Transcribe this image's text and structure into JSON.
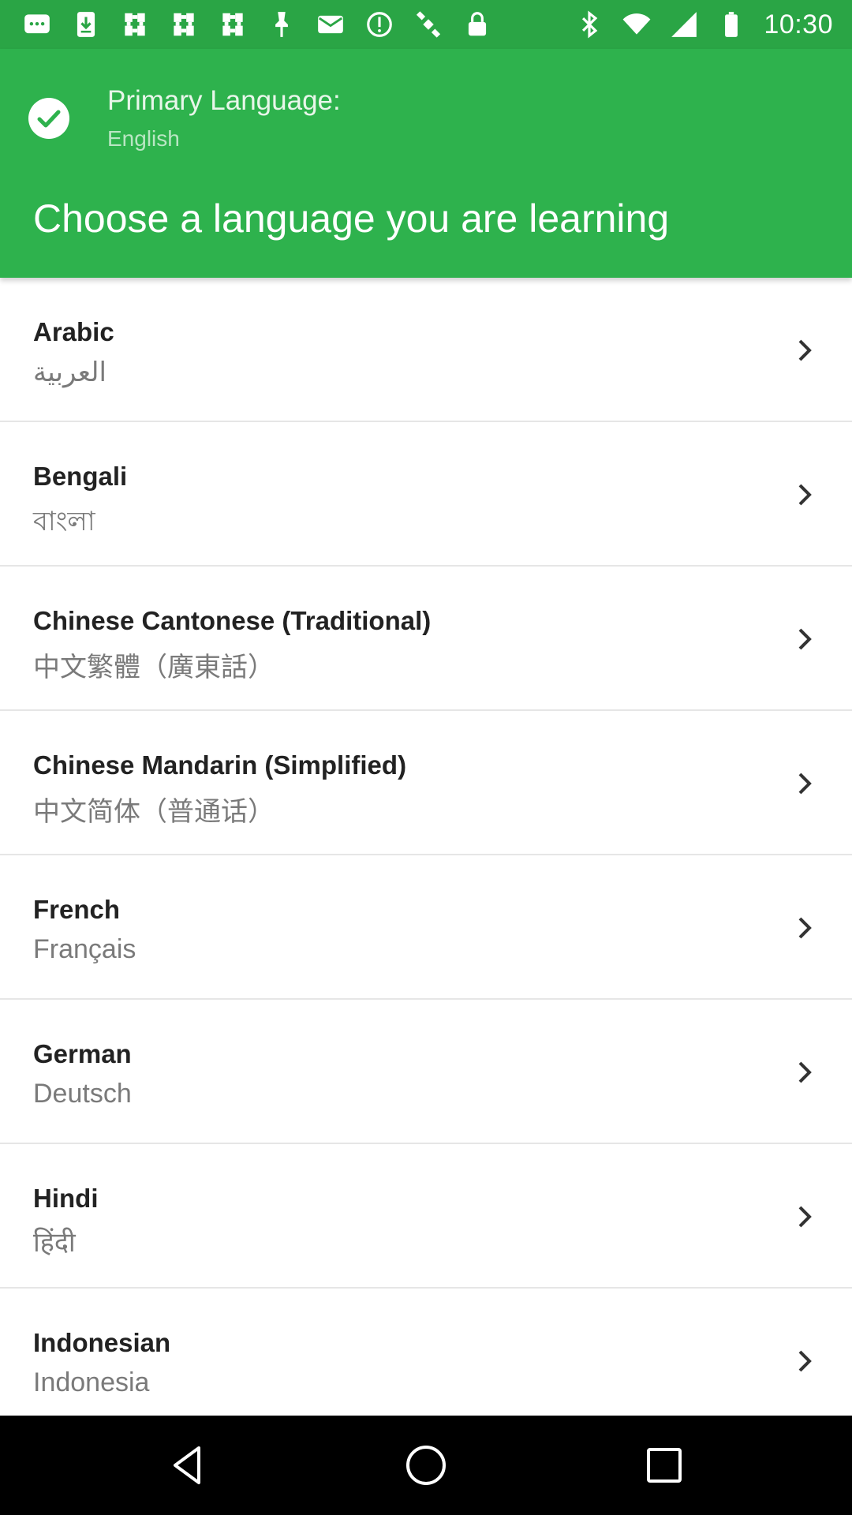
{
  "status_bar": {
    "time": "10:30",
    "left_icons": [
      "messages-icon",
      "download-icon",
      "slack-icon",
      "slack-icon",
      "slack-icon",
      "pin-icon",
      "mail-icon",
      "alarm-icon",
      "satellite-icon",
      "lock-icon"
    ],
    "right_icons": [
      "bluetooth-icon",
      "wifi-icon",
      "signal-icon",
      "battery-icon"
    ]
  },
  "header": {
    "primary_label": "Primary Language:",
    "primary_value": "English",
    "title": "Choose a language you are learning",
    "accent_color": "#2eb24d"
  },
  "languages": [
    {
      "name": "Arabic",
      "native": "العربية"
    },
    {
      "name": "Bengali",
      "native": "বাংলা"
    },
    {
      "name": "Chinese Cantonese (Traditional)",
      "native": "中文繁體（廣東話）"
    },
    {
      "name": "Chinese Mandarin (Simplified)",
      "native": "中文简体（普通话）"
    },
    {
      "name": "French",
      "native": "Français"
    },
    {
      "name": "German",
      "native": "Deutsch"
    },
    {
      "name": "Hindi",
      "native": "हिंदी"
    },
    {
      "name": "Indonesian",
      "native": "Indonesia"
    }
  ],
  "nav": {
    "buttons": [
      "back-icon",
      "home-icon",
      "recent-apps-icon"
    ]
  }
}
